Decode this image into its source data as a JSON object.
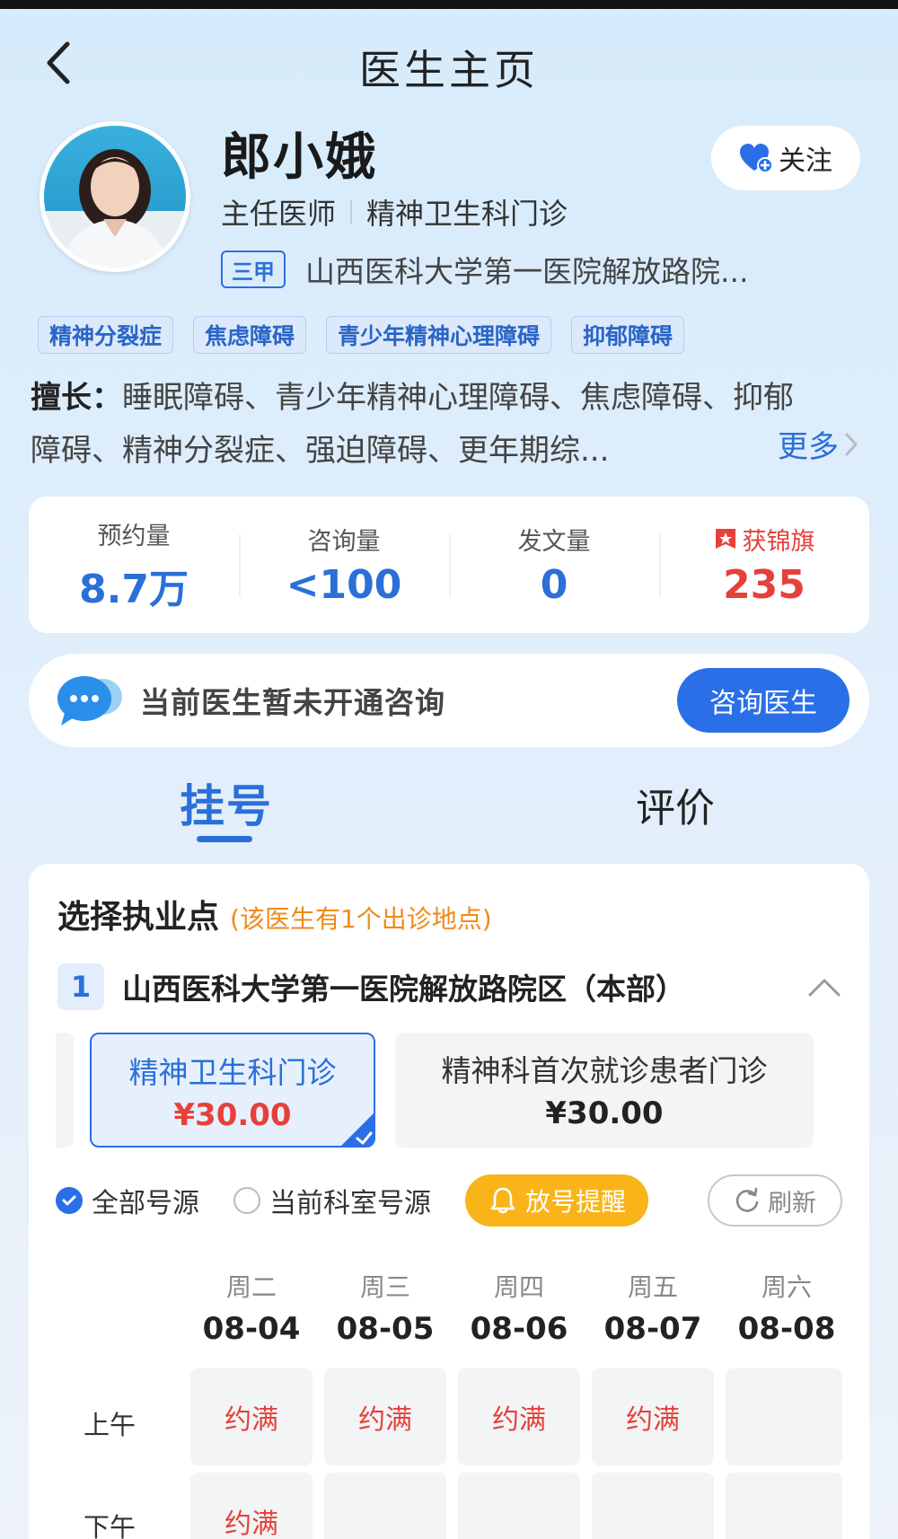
{
  "header": {
    "title": "医生主页"
  },
  "doctor": {
    "name": "郎小娥",
    "title": "主任医师",
    "department": "精神卫生科门诊",
    "hospital_level": "三甲",
    "hospital": "山西医科大学第一医院解放路院...",
    "follow_label": "关注"
  },
  "tags": [
    "精神分裂症",
    "焦虑障碍",
    "青少年精神心理障碍",
    "抑郁障碍"
  ],
  "specialty": {
    "label": "擅长：",
    "line1": "睡眠障碍、青少年精神心理障碍、焦虑障碍、抑郁",
    "line2": "障碍、精神分裂症、强迫障碍、更年期综...",
    "more": "更多"
  },
  "stats": [
    {
      "label": "预约量",
      "value": "8.7万"
    },
    {
      "label": "咨询量",
      "value": "<100"
    },
    {
      "label": "发文量",
      "value": "0"
    },
    {
      "label": "获锦旗",
      "value": "235"
    }
  ],
  "consult": {
    "text": "当前医生暂未开通咨询",
    "button": "咨询医生"
  },
  "tabs": {
    "register": "挂号",
    "review": "评价"
  },
  "schedule": {
    "title": "选择执业点",
    "subtitle": "(该医生有1个出诊地点)",
    "location_index": "1",
    "location_name": "山西医科大学第一医院解放路院区（本部）",
    "clinics": [
      {
        "name": "精神卫生科门诊",
        "price": "¥30.00",
        "selected": true
      },
      {
        "name": "精神科首次就诊患者门诊",
        "price": "¥30.00",
        "selected": false
      }
    ],
    "filters": {
      "all": "全部号源",
      "current": "当前科室号源",
      "remind": "放号提醒",
      "refresh": "刷新"
    },
    "days": [
      {
        "week": "周二",
        "date": "08-04"
      },
      {
        "week": "周三",
        "date": "08-05"
      },
      {
        "week": "周四",
        "date": "08-06"
      },
      {
        "week": "周五",
        "date": "08-07"
      },
      {
        "week": "周六",
        "date": "08-08"
      }
    ],
    "periods": [
      "上午",
      "下午"
    ],
    "morning": [
      "约满",
      "约满",
      "约满",
      "约满",
      ""
    ],
    "afternoon": [
      "约满",
      "",
      "",
      "",
      ""
    ]
  },
  "colors": {
    "accent": "#2b6fd8",
    "button_blue": "#2b6fe8",
    "red": "#e5413a",
    "orange": "#f08a1b",
    "remind_yellow": "#f9b419"
  },
  "icons": {
    "back": "chevron-left-icon",
    "follow": "heart-plus-icon",
    "banner": "flag-banner-icon",
    "consult": "chat-bubble-icon",
    "collapse": "chevron-up-icon",
    "bell": "bell-icon",
    "refresh": "refresh-icon"
  }
}
